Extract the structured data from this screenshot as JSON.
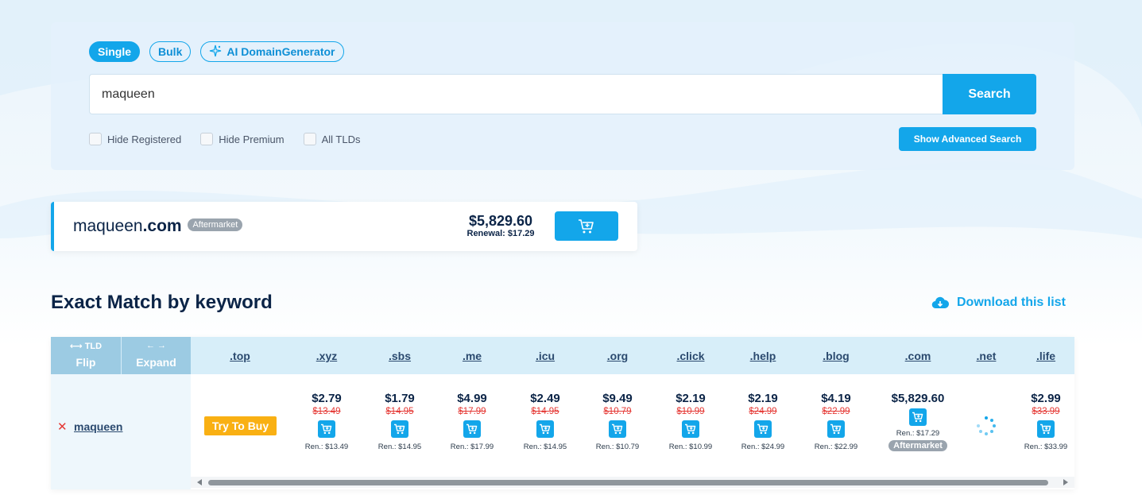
{
  "search": {
    "modes": [
      {
        "label": "Single",
        "active": true
      },
      {
        "label": "Bulk",
        "active": false
      },
      {
        "label": "AI DomainGenerator",
        "active": false,
        "icon": "sparkle-icon"
      }
    ],
    "query": "maqueen",
    "button_label": "Search",
    "filters": [
      {
        "label": "Hide Registered",
        "checked": false
      },
      {
        "label": "Hide Premium",
        "checked": false
      },
      {
        "label": "All TLDs",
        "checked": false
      }
    ],
    "advanced_label": "Show Advanced Search"
  },
  "featured": {
    "name_prefix": "maqueen",
    "name_tld": ".com",
    "badge": "Aftermarket",
    "price": "$5,829.60",
    "renewal": "Renewal: $17.29"
  },
  "section": {
    "title": "Exact Match by keyword",
    "download_label": "Download this list"
  },
  "table": {
    "flip": {
      "small": "⟷ TLD",
      "label": "Flip"
    },
    "expand": {
      "small": "← →",
      "label": "Expand"
    },
    "tlds": [
      ".top",
      ".xyz",
      ".sbs",
      ".me",
      ".icu",
      ".org",
      ".click",
      ".help",
      ".blog",
      ".com",
      ".net",
      ".life"
    ],
    "keyword": "maqueen",
    "status_icon": "x-icon",
    "try_label": "Try To Buy",
    "prices": [
      {
        "tld": ".xyz",
        "price": "$2.79",
        "old": "$13.49",
        "ren": "Ren.: $13.49"
      },
      {
        "tld": ".sbs",
        "price": "$1.79",
        "old": "$14.95",
        "ren": "Ren.: $14.95"
      },
      {
        "tld": ".me",
        "price": "$4.99",
        "old": "$17.99",
        "ren": "Ren.: $17.99"
      },
      {
        "tld": ".icu",
        "price": "$2.49",
        "old": "$14.95",
        "ren": "Ren.: $14.95"
      },
      {
        "tld": ".org",
        "price": "$9.49",
        "old": "$10.79",
        "ren": "Ren.: $10.79"
      },
      {
        "tld": ".click",
        "price": "$2.19",
        "old": "$10.99",
        "ren": "Ren.: $10.99"
      },
      {
        "tld": ".help",
        "price": "$2.19",
        "old": "$24.99",
        "ren": "Ren.: $24.99"
      },
      {
        "tld": ".blog",
        "price": "$4.19",
        "old": "$22.99",
        "ren": "Ren.: $22.99"
      }
    ],
    "com": {
      "price": "$5,829.60",
      "ren": "Ren.: $17.29",
      "badge": "Aftermarket"
    },
    "life": {
      "price": "$2.99",
      "old": "$33.99",
      "ren": "Ren.: $33.99"
    }
  },
  "colors": {
    "accent": "#13a6ea",
    "navy": "#0b2447",
    "strike": "#e53935",
    "try": "#f9b013"
  }
}
